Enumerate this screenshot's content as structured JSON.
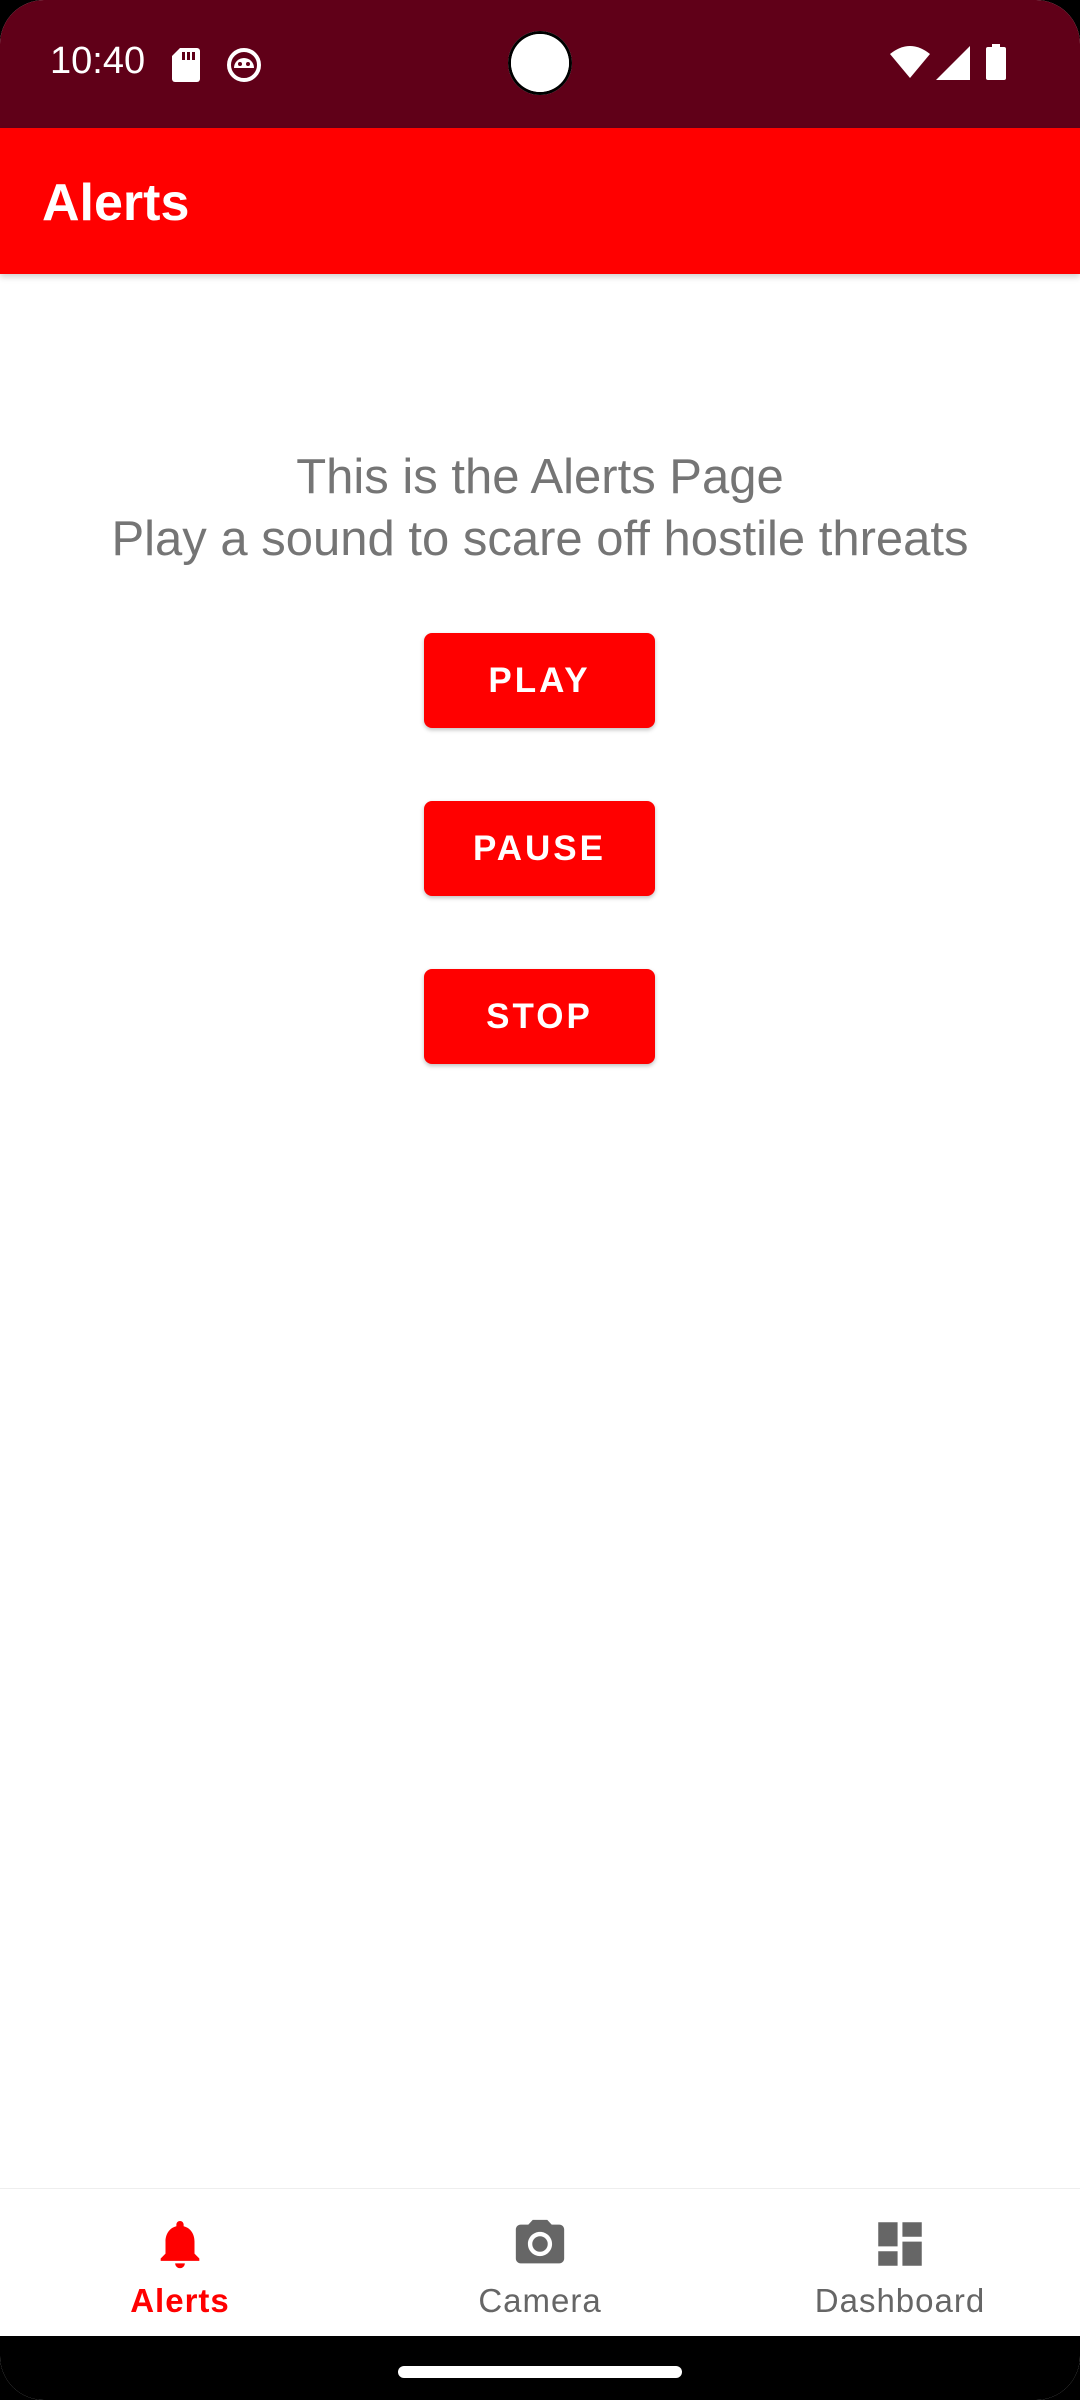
{
  "status_bar": {
    "time": "10:40",
    "icons": [
      "sd-card-icon",
      "android-debug-icon",
      "wifi-icon",
      "cell-signal-icon",
      "battery-icon"
    ],
    "background": "#600018"
  },
  "app_bar": {
    "title": "Alerts",
    "background": "#ff0000"
  },
  "main": {
    "intro_line_1": "This is the Alerts Page",
    "intro_line_2": "Play a sound to scare off hostile threats",
    "buttons": {
      "play": "PLAY",
      "pause": "PAUSE",
      "stop": "STOP"
    },
    "button_color": "#ff0000",
    "text_color": "#757575"
  },
  "bottom_nav": {
    "items": [
      {
        "label": "Alerts",
        "icon": "bell-icon",
        "active": true
      },
      {
        "label": "Camera",
        "icon": "camera-icon",
        "active": false
      },
      {
        "label": "Dashboard",
        "icon": "dashboard-icon",
        "active": false
      }
    ],
    "active_color": "#ff0000",
    "inactive_color": "#666666"
  }
}
